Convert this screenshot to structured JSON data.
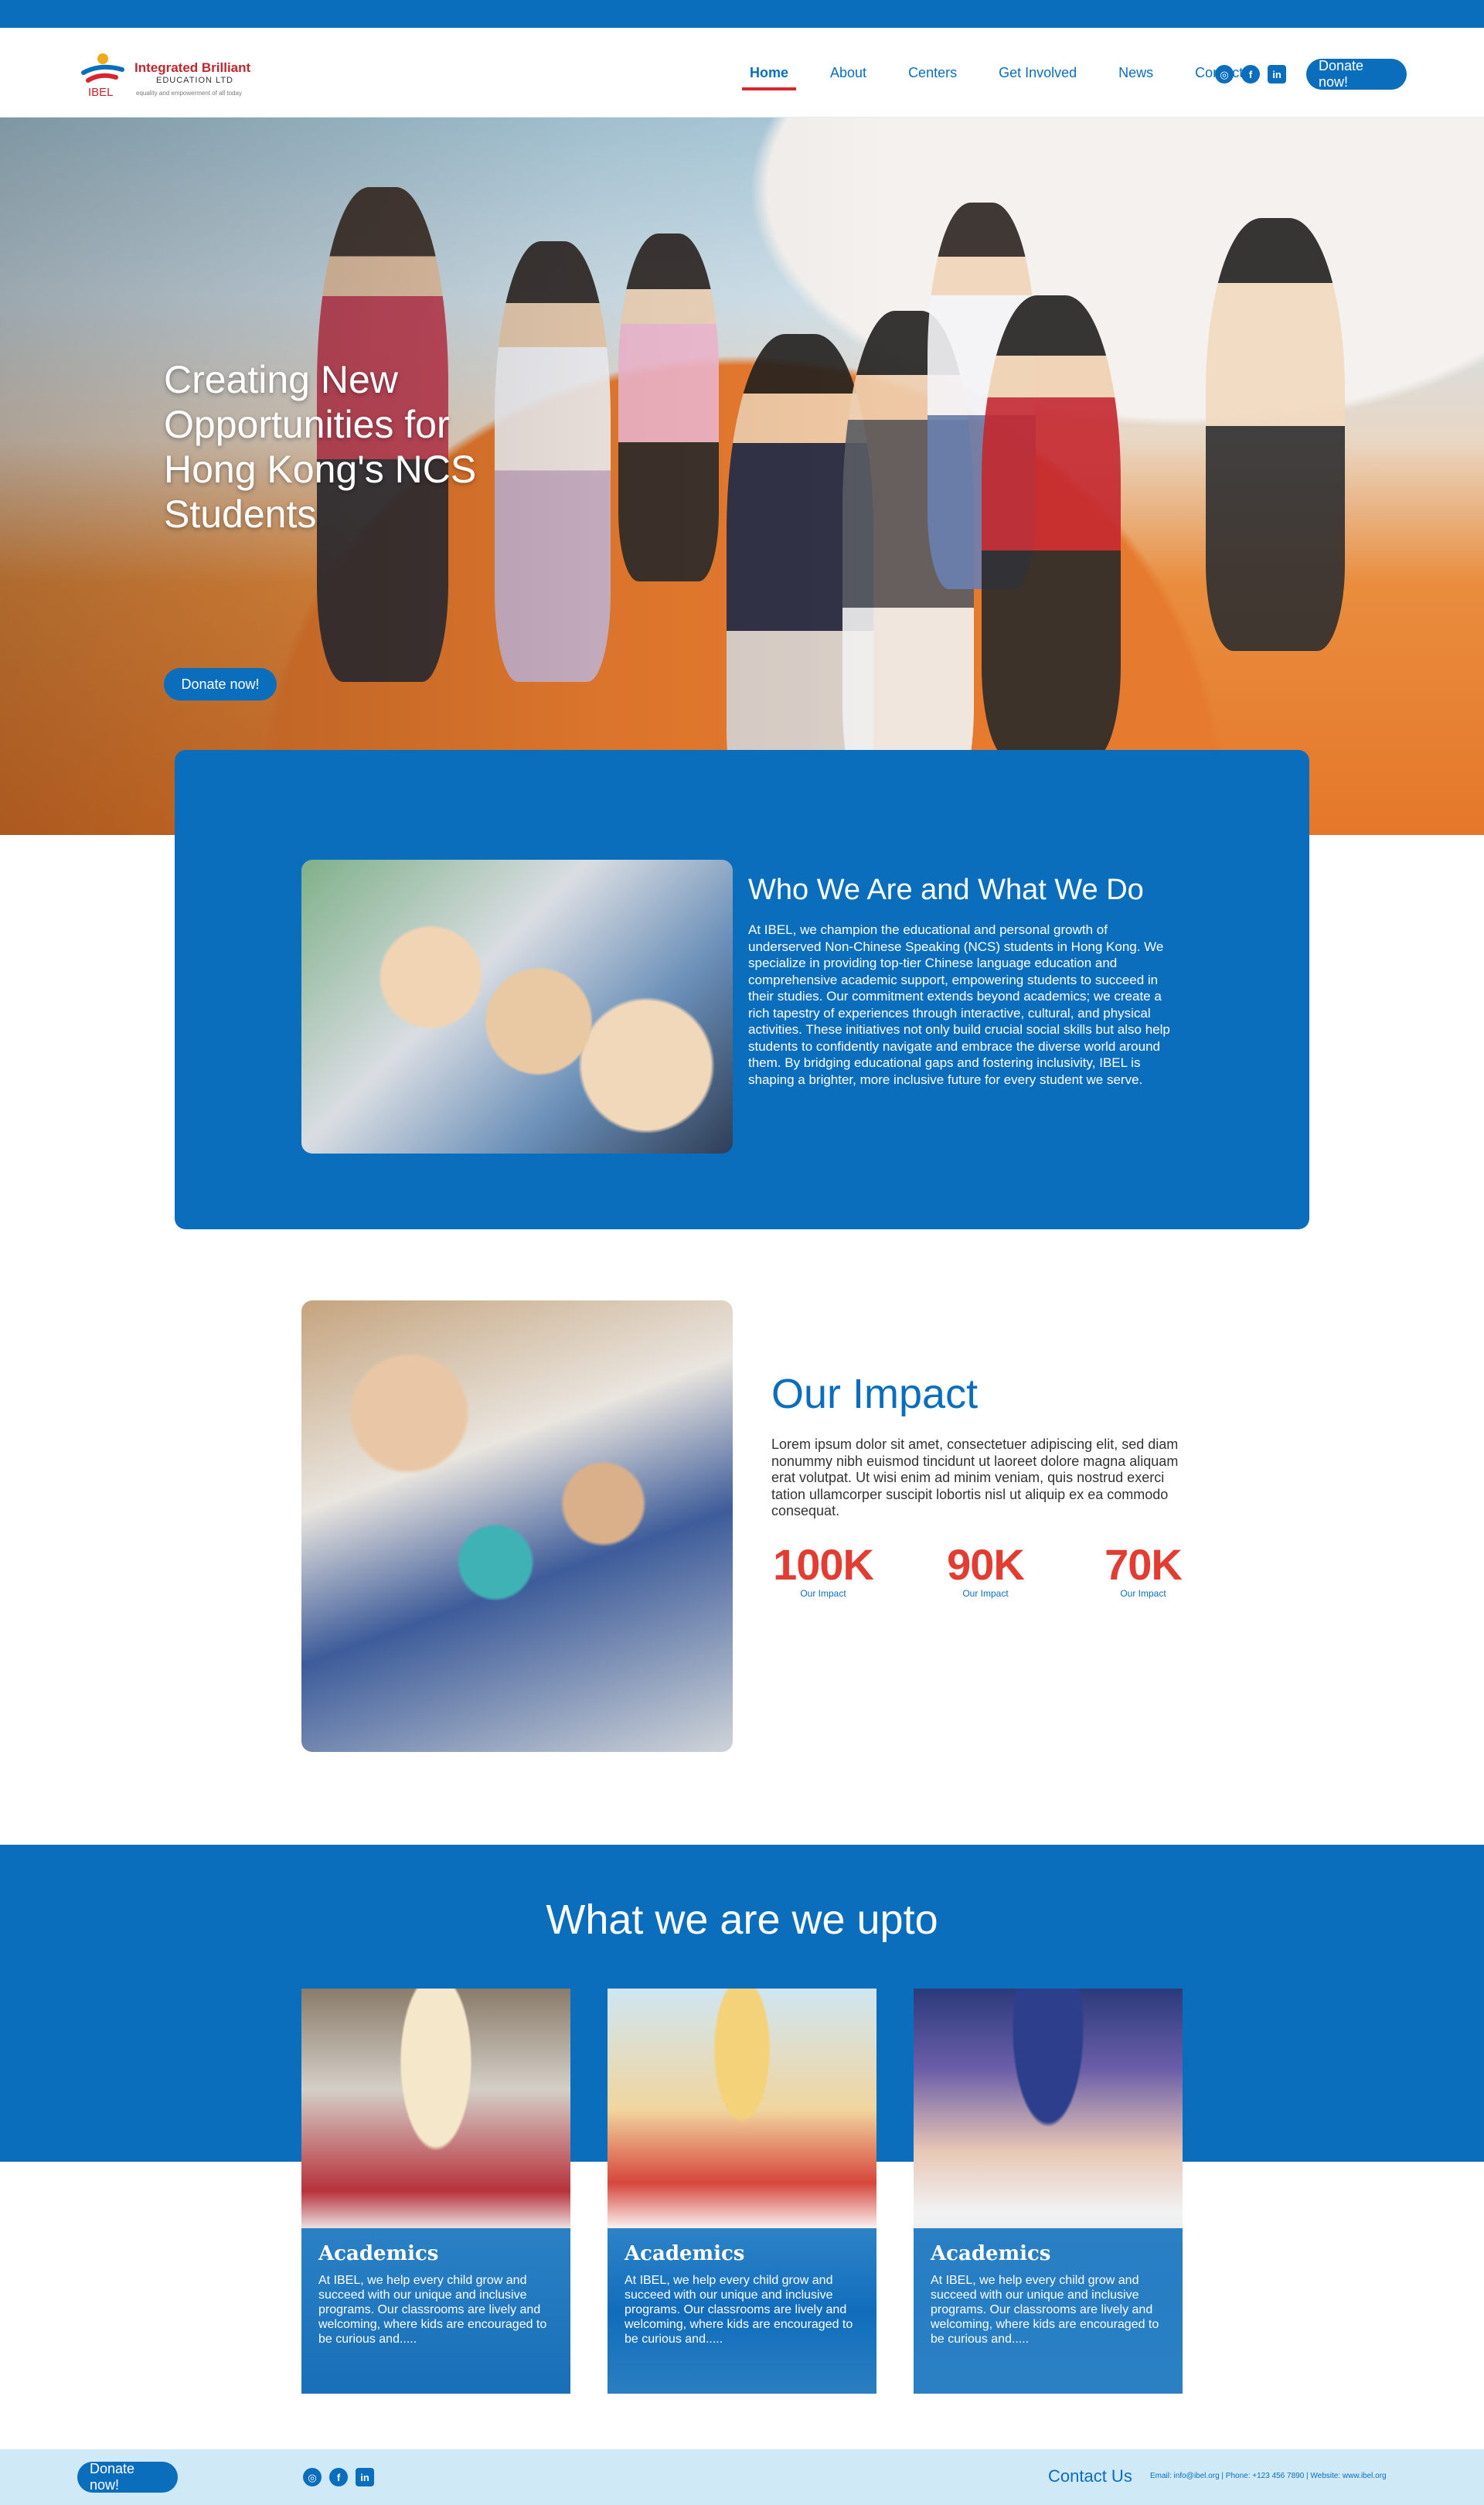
{
  "logo": {
    "name_line1": "Integrated Brilliant",
    "name_line2": "EDUCATION LTD",
    "badge": "IBEL",
    "tagline": "equality and empowerment of all today"
  },
  "nav": {
    "items": [
      "Home",
      "About",
      "Centers",
      "Get Involved",
      "News",
      "Contact"
    ],
    "active": "Home",
    "donate_label": "Donate now!"
  },
  "socials": [
    "instagram-icon",
    "facebook-icon",
    "linkedin-icon"
  ],
  "hero": {
    "title": "Creating New Opportunities for Hong Kong's NCS Students",
    "donate_label": "Donate now!"
  },
  "who": {
    "title": "Who We Are and What We Do",
    "text": "At IBEL, we champion the educational and personal growth of underserved Non-Chinese Speaking (NCS) students in Hong Kong. We specialize in providing top-tier Chinese language education and comprehensive academic support, empowering students to succeed in their studies. Our commitment extends beyond academics; we create a rich tapestry of experiences through interactive, cultural, and physical activities. These initiatives not only build crucial social skills but also help students to confidently navigate and embrace the diverse world around them. By bridging educational gaps and fostering inclusivity, IBEL is shaping a brighter, more inclusive future for every student we serve."
  },
  "impact": {
    "title": "Our Impact",
    "text": "Lorem ipsum dolor sit amet, consectetuer adipiscing elit, sed diam nonummy nibh euismod tincidunt ut laoreet dolore magna aliquam erat volutpat. Ut wisi enim ad minim veniam, quis nostrud exerci tation ullamcorper suscipit lobortis nisl ut aliquip ex ea commodo consequat.",
    "stats": [
      {
        "value": "100K",
        "label": "Our Impact"
      },
      {
        "value": "90K",
        "label": "Our Impact"
      },
      {
        "value": "70K",
        "label": "Our Impact"
      }
    ]
  },
  "upto": {
    "title": "What we are we upto",
    "cards": [
      {
        "title": "Academics",
        "text": "At IBEL, we help every child grow and succeed with our unique and inclusive programs. Our classrooms are lively and welcoming, where kids are encouraged to be curious and....."
      },
      {
        "title": "Academics",
        "text": "At IBEL, we help every child grow and succeed with our unique and inclusive programs. Our classrooms are lively and welcoming, where kids are encouraged to be curious and....."
      },
      {
        "title": "Academics",
        "text": "At IBEL, we help every child grow and succeed with our unique and inclusive programs. Our classrooms are lively and welcoming, where kids are encouraged to be curious and....."
      }
    ]
  },
  "footer": {
    "donate_label": "Donate now!",
    "contact_title": "Contact Us",
    "contact_info": "Email: info@ibel.org | Phone: +123 456 7890 | Website: www.ibel.org"
  },
  "colors": {
    "brand_blue": "#0a6ebd",
    "accent_red": "#e23d33",
    "footer_bg": "#cfe9f7"
  }
}
